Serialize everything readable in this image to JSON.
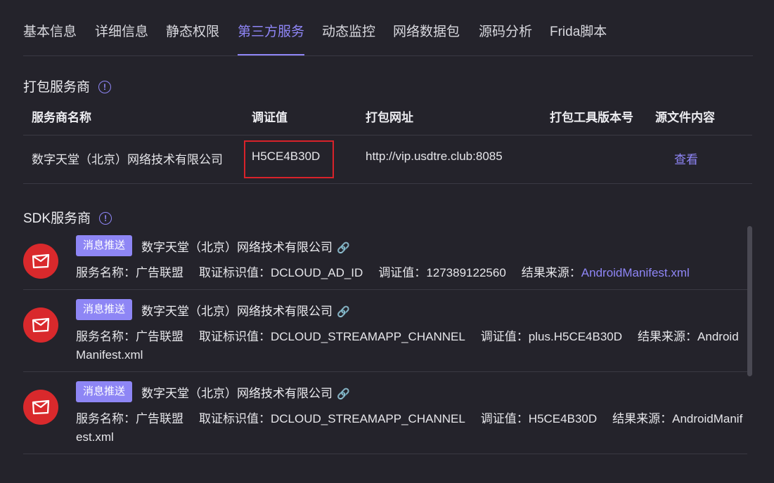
{
  "tabs": [
    "基本信息",
    "详细信息",
    "静态权限",
    "第三方服务",
    "动态监控",
    "网络数据包",
    "源码分析",
    "Frida脚本"
  ],
  "active_tab": "第三方服务",
  "packing": {
    "title": "打包服务商",
    "columns": [
      "服务商名称",
      "调证值",
      "打包网址",
      "打包工具版本号",
      "源文件内容"
    ],
    "row": {
      "name": "数字天堂（北京）网络技术有限公司",
      "value": "H5CE4B30D",
      "url": "http://vip.usdtre.club:8085",
      "version": "",
      "action": "查看"
    }
  },
  "sdk": {
    "title": "SDK服务商",
    "items": [
      {
        "badge": "消息推送",
        "company": "数字天堂（北京）网络技术有限公司",
        "service_label": "服务名称：",
        "service": "广告联盟",
        "id_label": "取证标识值：",
        "id": "DCLOUD_AD_ID",
        "value_label": "调证值：",
        "value": "127389122560",
        "source_label": "结果来源：",
        "source": "AndroidManifest.xml"
      },
      {
        "badge": "消息推送",
        "company": "数字天堂（北京）网络技术有限公司",
        "service_label": "服务名称：",
        "service": "广告联盟",
        "id_label": "取证标识值：",
        "id": "DCLOUD_STREAMAPP_CHANNEL",
        "value_label": "调证值：",
        "value": "plus.H5CE4B30D",
        "source_label": "结果来源：",
        "source": "AndroidManifest.xml"
      },
      {
        "badge": "消息推送",
        "company": "数字天堂（北京）网络技术有限公司",
        "service_label": "服务名称：",
        "service": "广告联盟",
        "id_label": "取证标识值：",
        "id": "DCLOUD_STREAMAPP_CHANNEL",
        "value_label": "调证值：",
        "value": "H5CE4B30D",
        "source_label": "结果来源：",
        "source": "AndroidManifest.xml"
      }
    ]
  },
  "colors": {
    "accent": "#8f86f7",
    "highlight": "#d8222a",
    "icon_bg": "#d9292c",
    "background": "#24232b"
  }
}
